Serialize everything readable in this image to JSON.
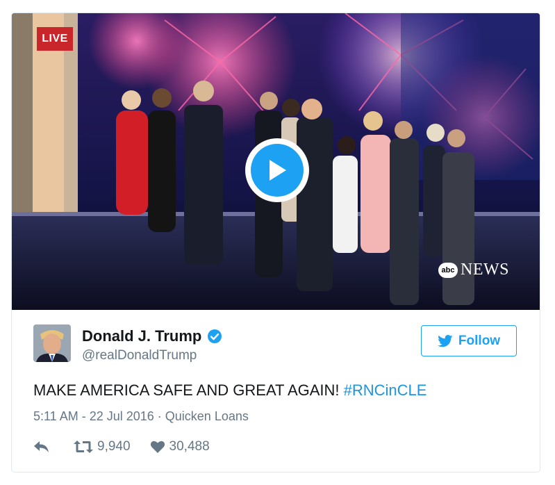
{
  "video": {
    "live_label": "LIVE",
    "network_logo_small": "abc",
    "network_logo_text": "NEWS",
    "play_icon": "play-icon"
  },
  "author": {
    "name": "Donald J. Trump",
    "handle": "@realDonaldTrump",
    "verified_icon": "verified-badge-icon"
  },
  "follow_button": {
    "label": "Follow",
    "icon": "twitter-bird-icon"
  },
  "tweet": {
    "text": "MAKE AMERICA SAFE AND GREAT AGAIN! ",
    "hashtag": "#RNCinCLE",
    "timestamp": "5:11 AM - 22 Jul 2016",
    "separator": " · ",
    "location": "Quicken Loans"
  },
  "actions": {
    "reply_icon": "reply-icon",
    "retweet_icon": "retweet-icon",
    "retweet_count": "9,940",
    "like_icon": "heart-icon",
    "like_count": "30,488"
  },
  "colors": {
    "accent": "#1da1f2",
    "hashtag": "#1b95e0",
    "secondary_text": "#657786",
    "live_badge": "#c8262b"
  }
}
